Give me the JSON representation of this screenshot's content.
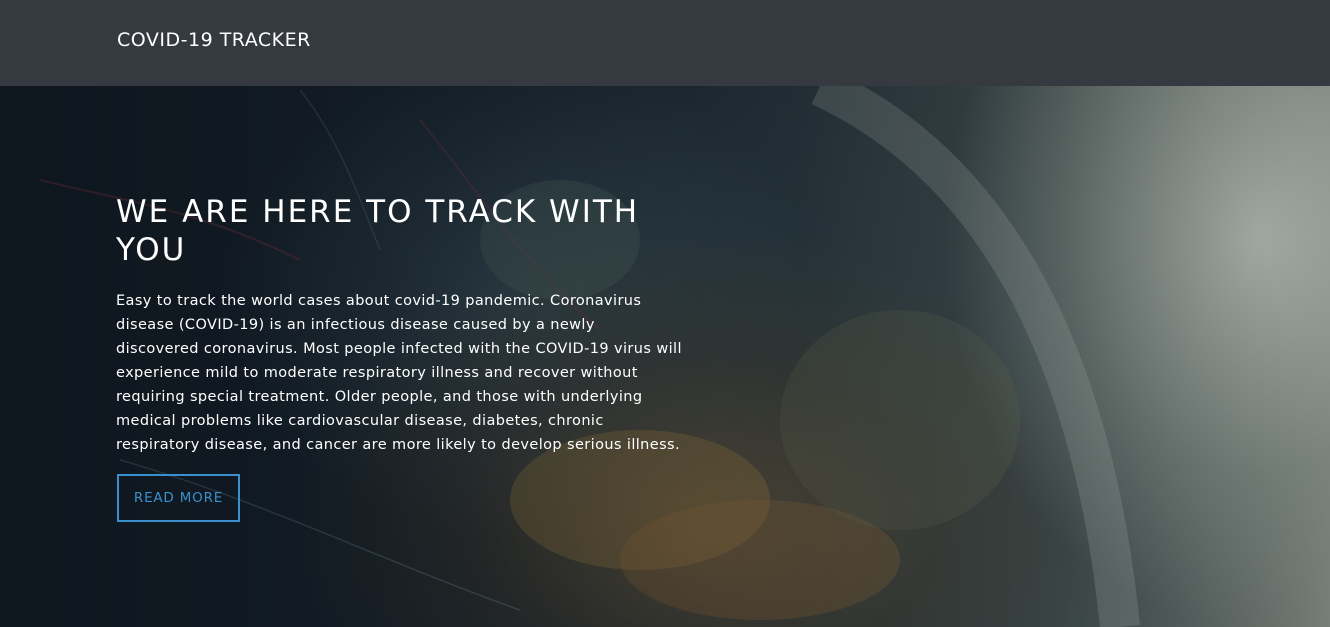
{
  "navbar": {
    "brand": "COVID-19 TRACKER"
  },
  "hero": {
    "title": "WE ARE HERE TO TRACK WITH YOU",
    "description": "Easy to track the world cases about covid-19 pandemic. Coronavirus disease (COVID-19) is an infectious disease caused by a newly discovered coronavirus. Most people infected with the COVID-19 virus will experience mild to moderate respiratory illness and recover without requiring special treatment. Older people, and those with underlying medical problems like cardiovascular disease, diabetes, chronic respiratory disease, and cancer are more likely to develop serious illness.",
    "button_label": "READ MORE",
    "background_image": "globe-map-photo"
  },
  "colors": {
    "navbar_bg": "#343a40",
    "accent": "#3a8fce",
    "text": "#ffffff"
  }
}
